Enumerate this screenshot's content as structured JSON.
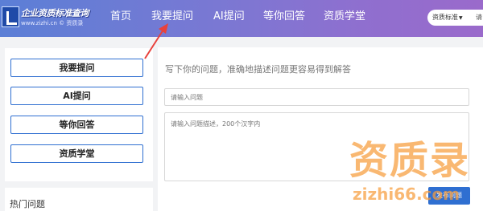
{
  "header": {
    "logo_title": "企业资质标准查询",
    "logo_subtitle": "www.zizhi.cn © 资质录",
    "nav": [
      "首页",
      "我要提问",
      "AI提问",
      "等你回答",
      "资质学堂"
    ],
    "select_label": "资质标准",
    "search_stub": "请"
  },
  "sidebar": {
    "buttons": [
      "我要提问",
      "AI提问",
      "等你回答",
      "资质学堂"
    ],
    "hot_title": "热门问题"
  },
  "main": {
    "hint": "写下你的问题，准确地描述问题更容易得到解答",
    "title_placeholder": "请输入问题",
    "desc_placeholder": "请输入问题描述，200个汉字内",
    "publish_label": "发布问题"
  },
  "watermark": {
    "text": "资质录",
    "url": "zizhi66.com"
  },
  "colors": {
    "accent": "#2f6fd1",
    "header_start": "#5b7fd6",
    "header_end": "#9a6acb",
    "annotation_arrow": "#e8413c",
    "watermark": "#f69c3c"
  }
}
